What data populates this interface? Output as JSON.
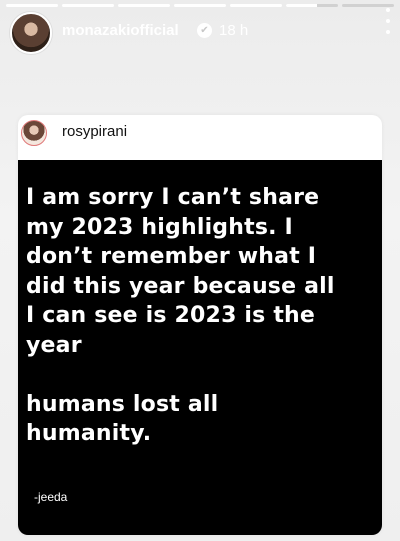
{
  "story": {
    "progress_segments": [
      1,
      1,
      1,
      1,
      1,
      0.6,
      0
    ],
    "account": {
      "username": "monazakiofficial",
      "verified": true,
      "time_ago": "18 h"
    },
    "icons": {
      "verified": "verified-badge-icon",
      "more": "more-vertical-icon"
    }
  },
  "shared_post": {
    "username": "rosypirani",
    "text_lines": [
      "I am sorry I can’t share",
      "my 2023 highlights. I",
      "don’t remember what I",
      "did this year because all",
      "I can see is 2023 is the",
      "year",
      "",
      "humans lost all",
      "humanity."
    ],
    "author": "-jeeda",
    "background": "#000000",
    "text_color": "#ffffff"
  }
}
